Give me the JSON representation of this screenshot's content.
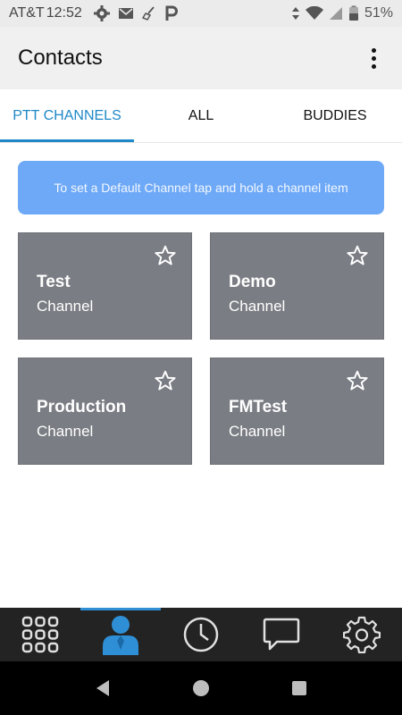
{
  "status_bar": {
    "carrier": "AT&T",
    "time": "12:52",
    "battery": "51%"
  },
  "app_bar": {
    "title": "Contacts"
  },
  "tabs": [
    {
      "label": "PTT CHANNELS",
      "active": true
    },
    {
      "label": "ALL",
      "active": false
    },
    {
      "label": "BUDDIES",
      "active": false
    }
  ],
  "info_banner": {
    "text": "To set a Default Channel tap and hold a channel item"
  },
  "channels": [
    {
      "name": "Test",
      "type": "Channel"
    },
    {
      "name": "Demo",
      "type": "Channel"
    },
    {
      "name": "Production",
      "type": "Channel"
    },
    {
      "name": "FMTest",
      "type": "Channel"
    }
  ],
  "bottom_nav": {
    "items": [
      "apps-grid-icon",
      "contacts-person-icon",
      "history-clock-icon",
      "messages-chat-icon",
      "settings-gear-icon"
    ],
    "active_index": 1
  },
  "colors": {
    "accent": "#1e88c8",
    "banner": "#6ea9f7",
    "tile": "#7a7d83",
    "bottom_nav": "#232323"
  }
}
